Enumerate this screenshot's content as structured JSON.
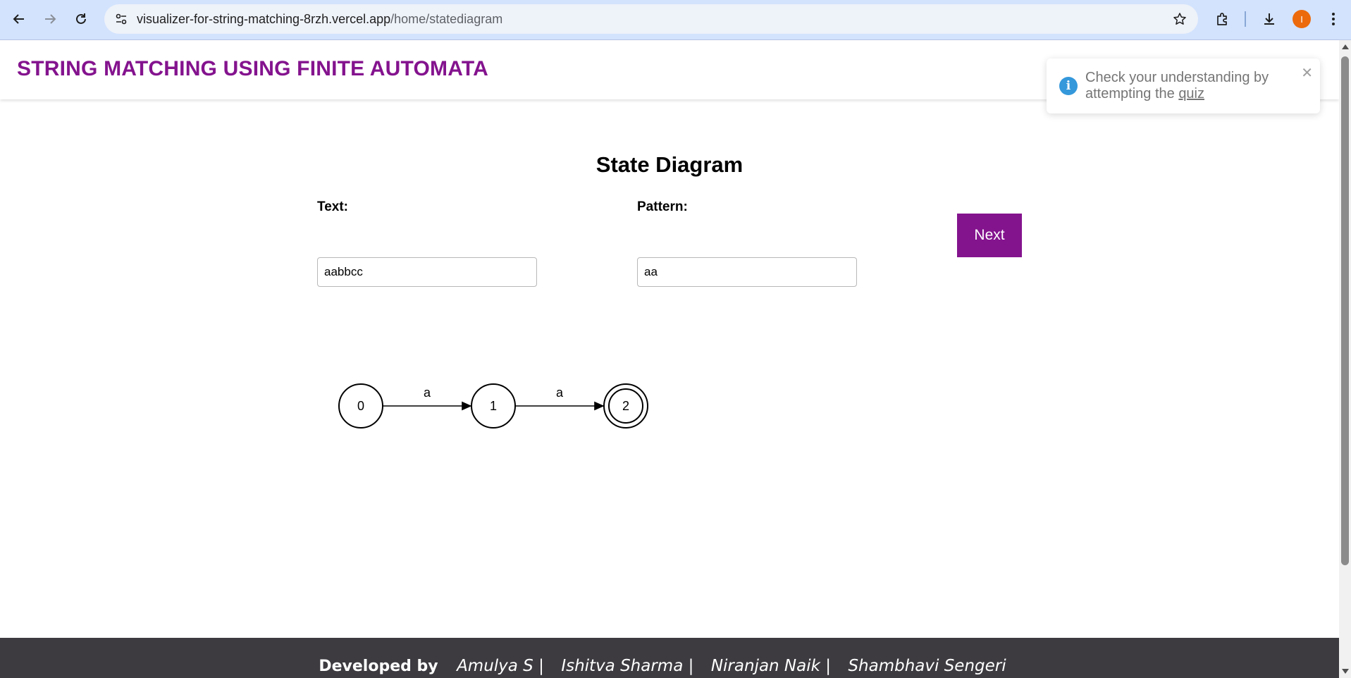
{
  "browser": {
    "url_host": "visualizer-for-string-matching-8rzh.vercel.app",
    "url_path": "/home/statediagram",
    "avatar_initial": "I"
  },
  "app": {
    "title": "STRING MATCHING USING FINITE AUTOMATA",
    "accent_color": "#84138e"
  },
  "toast": {
    "message": "Check your understanding by attempting the ",
    "link_text": "quiz",
    "close_glyph": "✕"
  },
  "page": {
    "heading": "State Diagram",
    "text_label": "Text:",
    "text_value": "aabbcc",
    "pattern_label": "Pattern:",
    "pattern_value": "aa",
    "next_label": "Next"
  },
  "state_diagram": {
    "states": [
      "0",
      "1",
      "2"
    ],
    "accepting_state": "2",
    "transitions": [
      {
        "from": "0",
        "to": "1",
        "label": "a"
      },
      {
        "from": "1",
        "to": "2",
        "label": "a"
      }
    ]
  },
  "footer": {
    "developed_by": "Developed by",
    "names": [
      "Amulya S |",
      "Ishitva Sharma |",
      "Niranjan Naik |",
      "Shambhavi Sengeri"
    ]
  }
}
